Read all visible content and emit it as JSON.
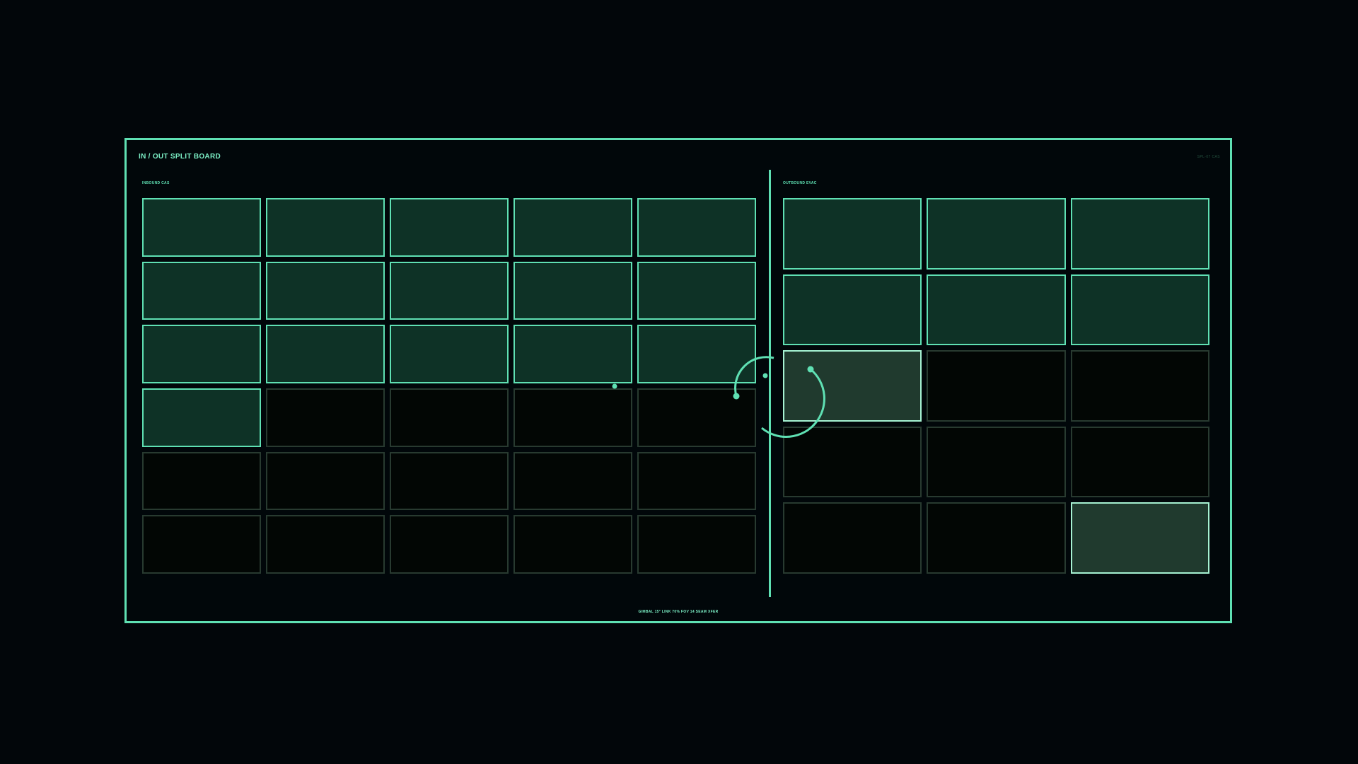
{
  "board": {
    "title": "IN / OUT SPLIT BOARD",
    "code": "SPL-07 CAS",
    "footer": "GIMBAL 15°  LINK 70%  FOV 14  SEAM XFER"
  },
  "inbound": {
    "label": "INBOUND CAS",
    "columns": 5,
    "rows": 6,
    "cells": [
      "filled",
      "filled",
      "filled",
      "filled",
      "filled",
      "filled",
      "filled",
      "filled",
      "filled",
      "filled",
      "filled",
      "filled",
      "filled",
      "filled",
      "filled",
      "filled",
      "empty",
      "empty",
      "empty",
      "empty",
      "empty",
      "empty",
      "empty",
      "empty",
      "empty",
      "empty",
      "empty",
      "empty",
      "empty",
      "empty"
    ]
  },
  "outbound": {
    "label": "OUTBOUND EVAC",
    "columns": 3,
    "rows": 5,
    "cells": [
      "filled",
      "filled",
      "filled",
      "filled",
      "filled",
      "filled",
      "selected",
      "empty",
      "empty",
      "empty",
      "empty",
      "empty",
      "empty",
      "empty",
      "selected"
    ]
  },
  "colors": {
    "accent": "#5fe0b3",
    "filled": "#0e3226",
    "selected": "#203a2e",
    "empty": "#020604",
    "background": "#02060a"
  },
  "icons": {
    "transfer_gesture": "circular-transfer-icon"
  }
}
